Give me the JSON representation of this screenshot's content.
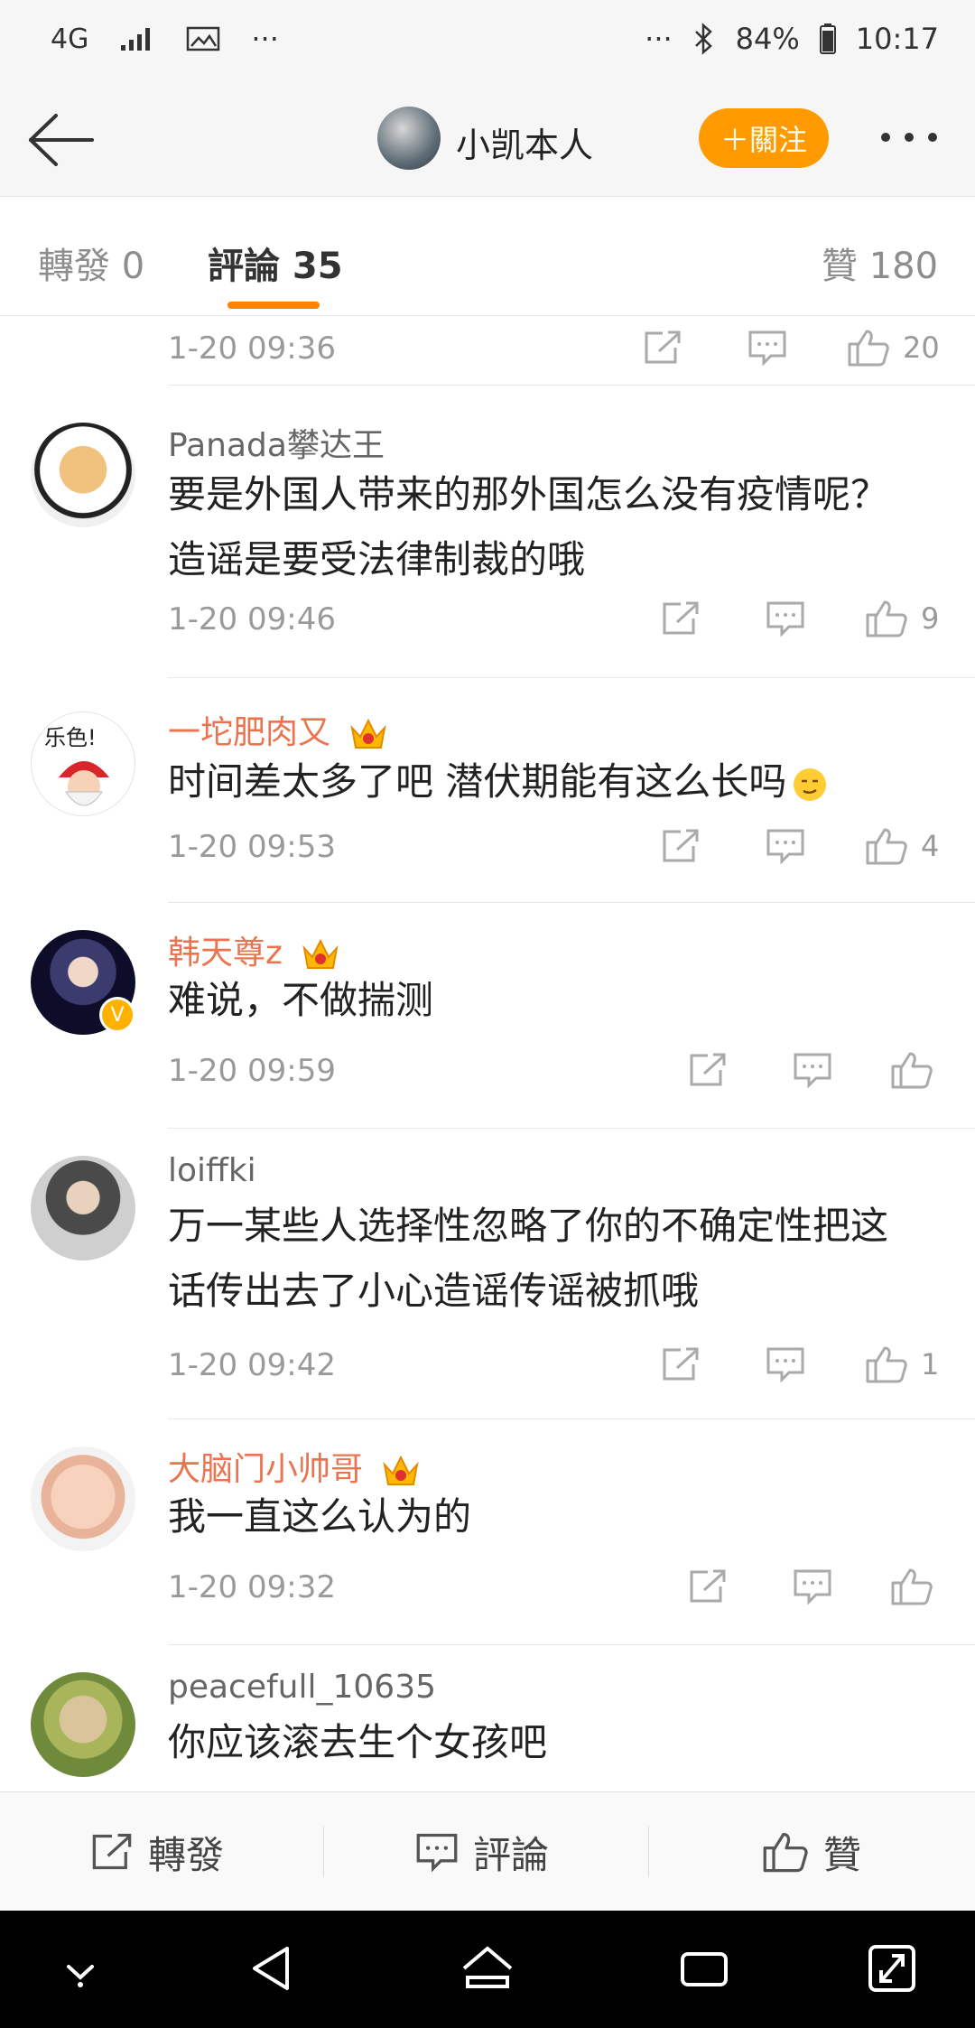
{
  "status_bar": {
    "network": "4G",
    "extra": "···",
    "dots": "···",
    "battery": "84%",
    "time": "10:17"
  },
  "header": {
    "title": "小凯本人",
    "follow_label": "＋關注"
  },
  "tabs": {
    "repost": "轉發 0",
    "comments": "評論 35",
    "likes": "贊 180"
  },
  "top_row": {
    "time": "1-20 09:36",
    "likes": "20"
  },
  "comments": [
    {
      "name": "Panada攀达王",
      "text_lines": [
        "要是外国人带来的那外国怎么没有疫情呢？",
        "造谣是要受法律制裁的哦"
      ],
      "time": "1-20 09:46",
      "likes": "9"
    },
    {
      "name": "一坨肥肉又",
      "text_lines": [
        "时间差太多了吧 潜伏期能有这么长吗"
      ],
      "time": "1-20 09:53",
      "likes": "4"
    },
    {
      "name": "韩天尊z",
      "text_lines": [
        "难说，不做揣测"
      ],
      "time": "1-20 09:59",
      "likes": ""
    },
    {
      "name": "loiffki",
      "text_lines": [
        "万一某些人选择性忽略了你的不确定性把这",
        "话传出去了小心造谣传谣被抓哦"
      ],
      "time": "1-20 09:42",
      "likes": "1"
    },
    {
      "name": "大脑门小帅哥",
      "text_lines": [
        "我一直这么认为的"
      ],
      "time": "1-20 09:32",
      "likes": ""
    },
    {
      "name": "peacefull_10635",
      "text_lines": [
        "你应该滚去生个女孩吧"
      ],
      "time": "",
      "likes": ""
    }
  ],
  "bottom_bar": {
    "repost": "轉發",
    "comment": "評論",
    "like": "贊"
  },
  "colors": {
    "accent": "#ff8200",
    "follow": "#ff9a00",
    "vip_name": "#eb7350"
  }
}
